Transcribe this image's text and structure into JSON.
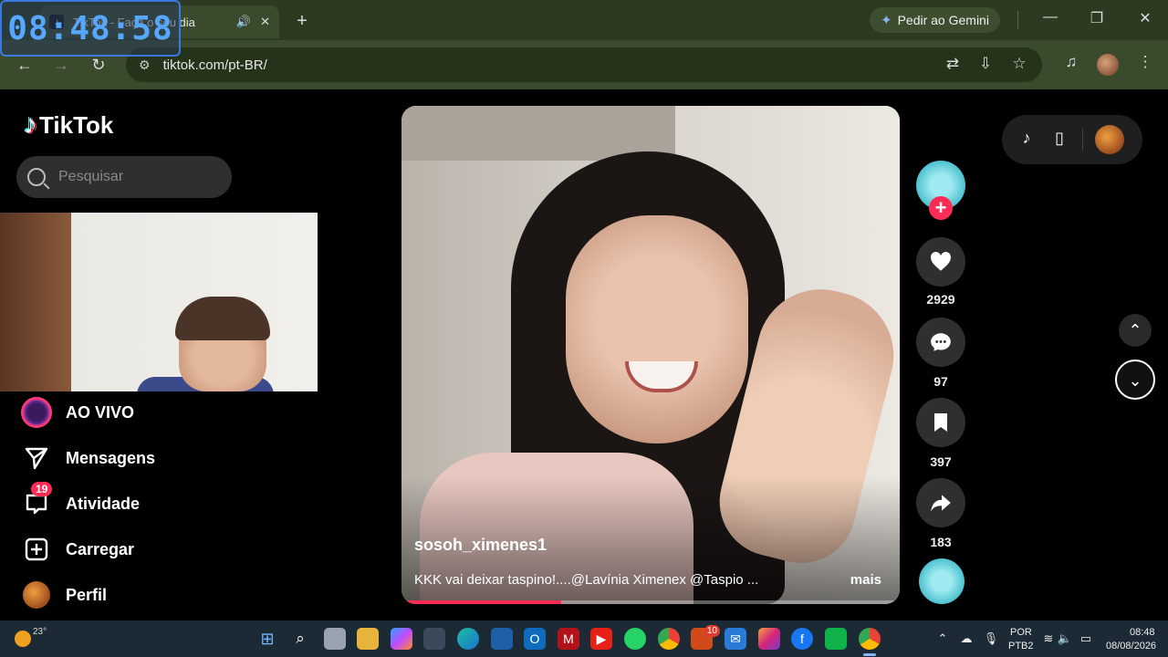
{
  "overlay": {
    "clock": "08:48:58"
  },
  "browser": {
    "tab_title": "TikTok - Faça o seu dia",
    "new_tab_symbol": "+",
    "gemini_label": "Pedir ao Gemini",
    "url": "tiktok.com/pt-BR/"
  },
  "tiktok": {
    "brand": "TikTok",
    "search_placeholder": "Pesquisar",
    "menu": [
      {
        "label": "AO VIVO",
        "icon": "live-icon"
      },
      {
        "label": "Mensagens",
        "icon": "send-icon"
      },
      {
        "label": "Atividade",
        "icon": "inbox-icon",
        "badge": "19"
      },
      {
        "label": "Carregar",
        "icon": "upload-icon"
      },
      {
        "label": "Perfil",
        "icon": "profile-icon"
      }
    ],
    "video": {
      "author": "sosoh_ximenes1",
      "caption": "KKK vai deixar taspino!....@Lavínia Ximenex @Taspio ...",
      "more_label": "mais",
      "progress": 0.32
    },
    "actions": {
      "likes": "2929",
      "comments": "97",
      "saves": "397",
      "shares": "183"
    }
  },
  "taskbar": {
    "temperature": "23°",
    "language": "POR",
    "layout": "PTB2",
    "time": "08:48",
    "date": "08/08/2026",
    "badge_count": "10"
  },
  "colors": {
    "accent": "#fe2c55",
    "tabbar": "#2b3a20",
    "toolbar": "#3a4a2c",
    "taskbar": "#1c2a36"
  }
}
